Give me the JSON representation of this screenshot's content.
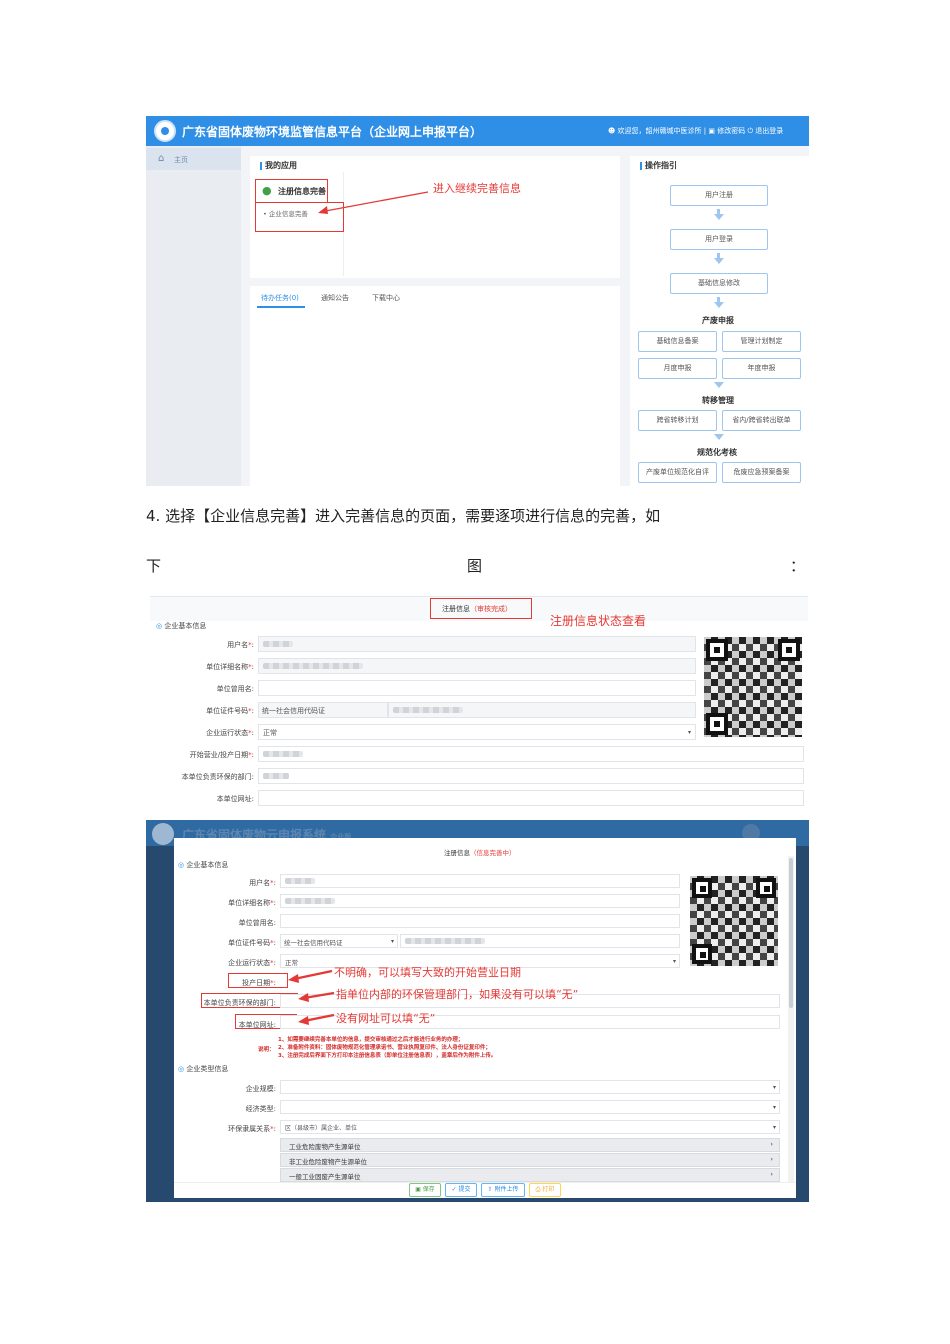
{
  "shot1": {
    "platform_title": "广东省固体废物环境监管信息平台（企业网上申报平台）",
    "user_welcome": "欢迎您，",
    "user_name": "韶州赣城中医诊所",
    "change_password": "修改密码",
    "logout": "退出登录",
    "nav_home": "主页",
    "my_apps_title": "我的应用",
    "app_register": "注册信息完善",
    "app_sub_item": "• 企业信息完善",
    "annotation_continue": "进入继续完善信息",
    "tabs": [
      "待办任务(0)",
      "通知公告",
      "下载中心"
    ],
    "guide_title": "操作指引",
    "flow_steps": [
      "用户注册",
      "用户登录",
      "基础信息修改"
    ],
    "section_waste": "产废申报",
    "waste_buttons": [
      "基础信息备案",
      "管理计划制定",
      "月度申报",
      "年度申报"
    ],
    "section_transfer": "转移管理",
    "transfer_buttons": [
      "跨省转移计划",
      "省内/跨省转出联单"
    ],
    "section_standard": "规范化考核",
    "standard_buttons": [
      "产废单位规范化自评",
      "危废应急预案备案"
    ]
  },
  "text": {
    "para_line1": "4. 选择【企业信息完善】进入完善信息的页面，需要逐项进行信息的完善，如",
    "para_line2_left": "下",
    "para_line2_mid": "图",
    "para_line2_right": "："
  },
  "shot2": {
    "reg_info_label": "注册信息",
    "reg_status": "（审核完成）",
    "annotation_status": "注册信息状态查看",
    "section_basic": "企业基本信息",
    "labels": [
      "用户名",
      "单位详细名称",
      "单位曾用名",
      "单位证件号码",
      "企业运行状态",
      "开始营业/投产日期",
      "本单位负责环保的部门",
      "本单位网址"
    ],
    "id_type": "统一社会信用代码证",
    "run_status": "正常"
  },
  "shot3": {
    "bg_title": "广东省固体废物云申报系统",
    "bg_tag": "企业版",
    "reg_info_label": "注册信息",
    "reg_status": "（信息完善中）",
    "section_basic": "企业基本信息",
    "labels": [
      "用户名",
      "单位详细名称",
      "单位曾用名",
      "单位证件号码",
      "企业运行状态",
      "投产日期",
      "本单位负责环保的部门",
      "本单位网址"
    ],
    "id_type": "统一社会信用代码证",
    "run_status": "正常",
    "note_date": "不明确，可以填写大致的开始营业日期",
    "note_dept": "指单位内部的环保管理部门，如果没有可以填“无”",
    "note_site": "没有网址可以填“无”",
    "explain_label": "说明：",
    "explain_lines": [
      "1、如需要继续完善本单位的信息，提交审核通过之后才能进行业务的办理；",
      "2、准备附件资料：固体废物规范化管理承诺书、营业执照复印件、法人身份证复印件；",
      "3、注册完成后界面下方打印本注册信息表（即单位注册信息表），盖章后作为附件上传。"
    ],
    "section_type": "企业类型信息",
    "type_labels": [
      "企业规模",
      "经济类型",
      "环保隶属关系"
    ],
    "affiliation_value": "区（县级市）属企业、单位",
    "accordions": [
      "工业危险废物产生源单位",
      "非工业危险废物产生源单位",
      "一般工业固废产生源单位"
    ],
    "actions": [
      "保存",
      "提交",
      "附件上传",
      "打印"
    ]
  }
}
